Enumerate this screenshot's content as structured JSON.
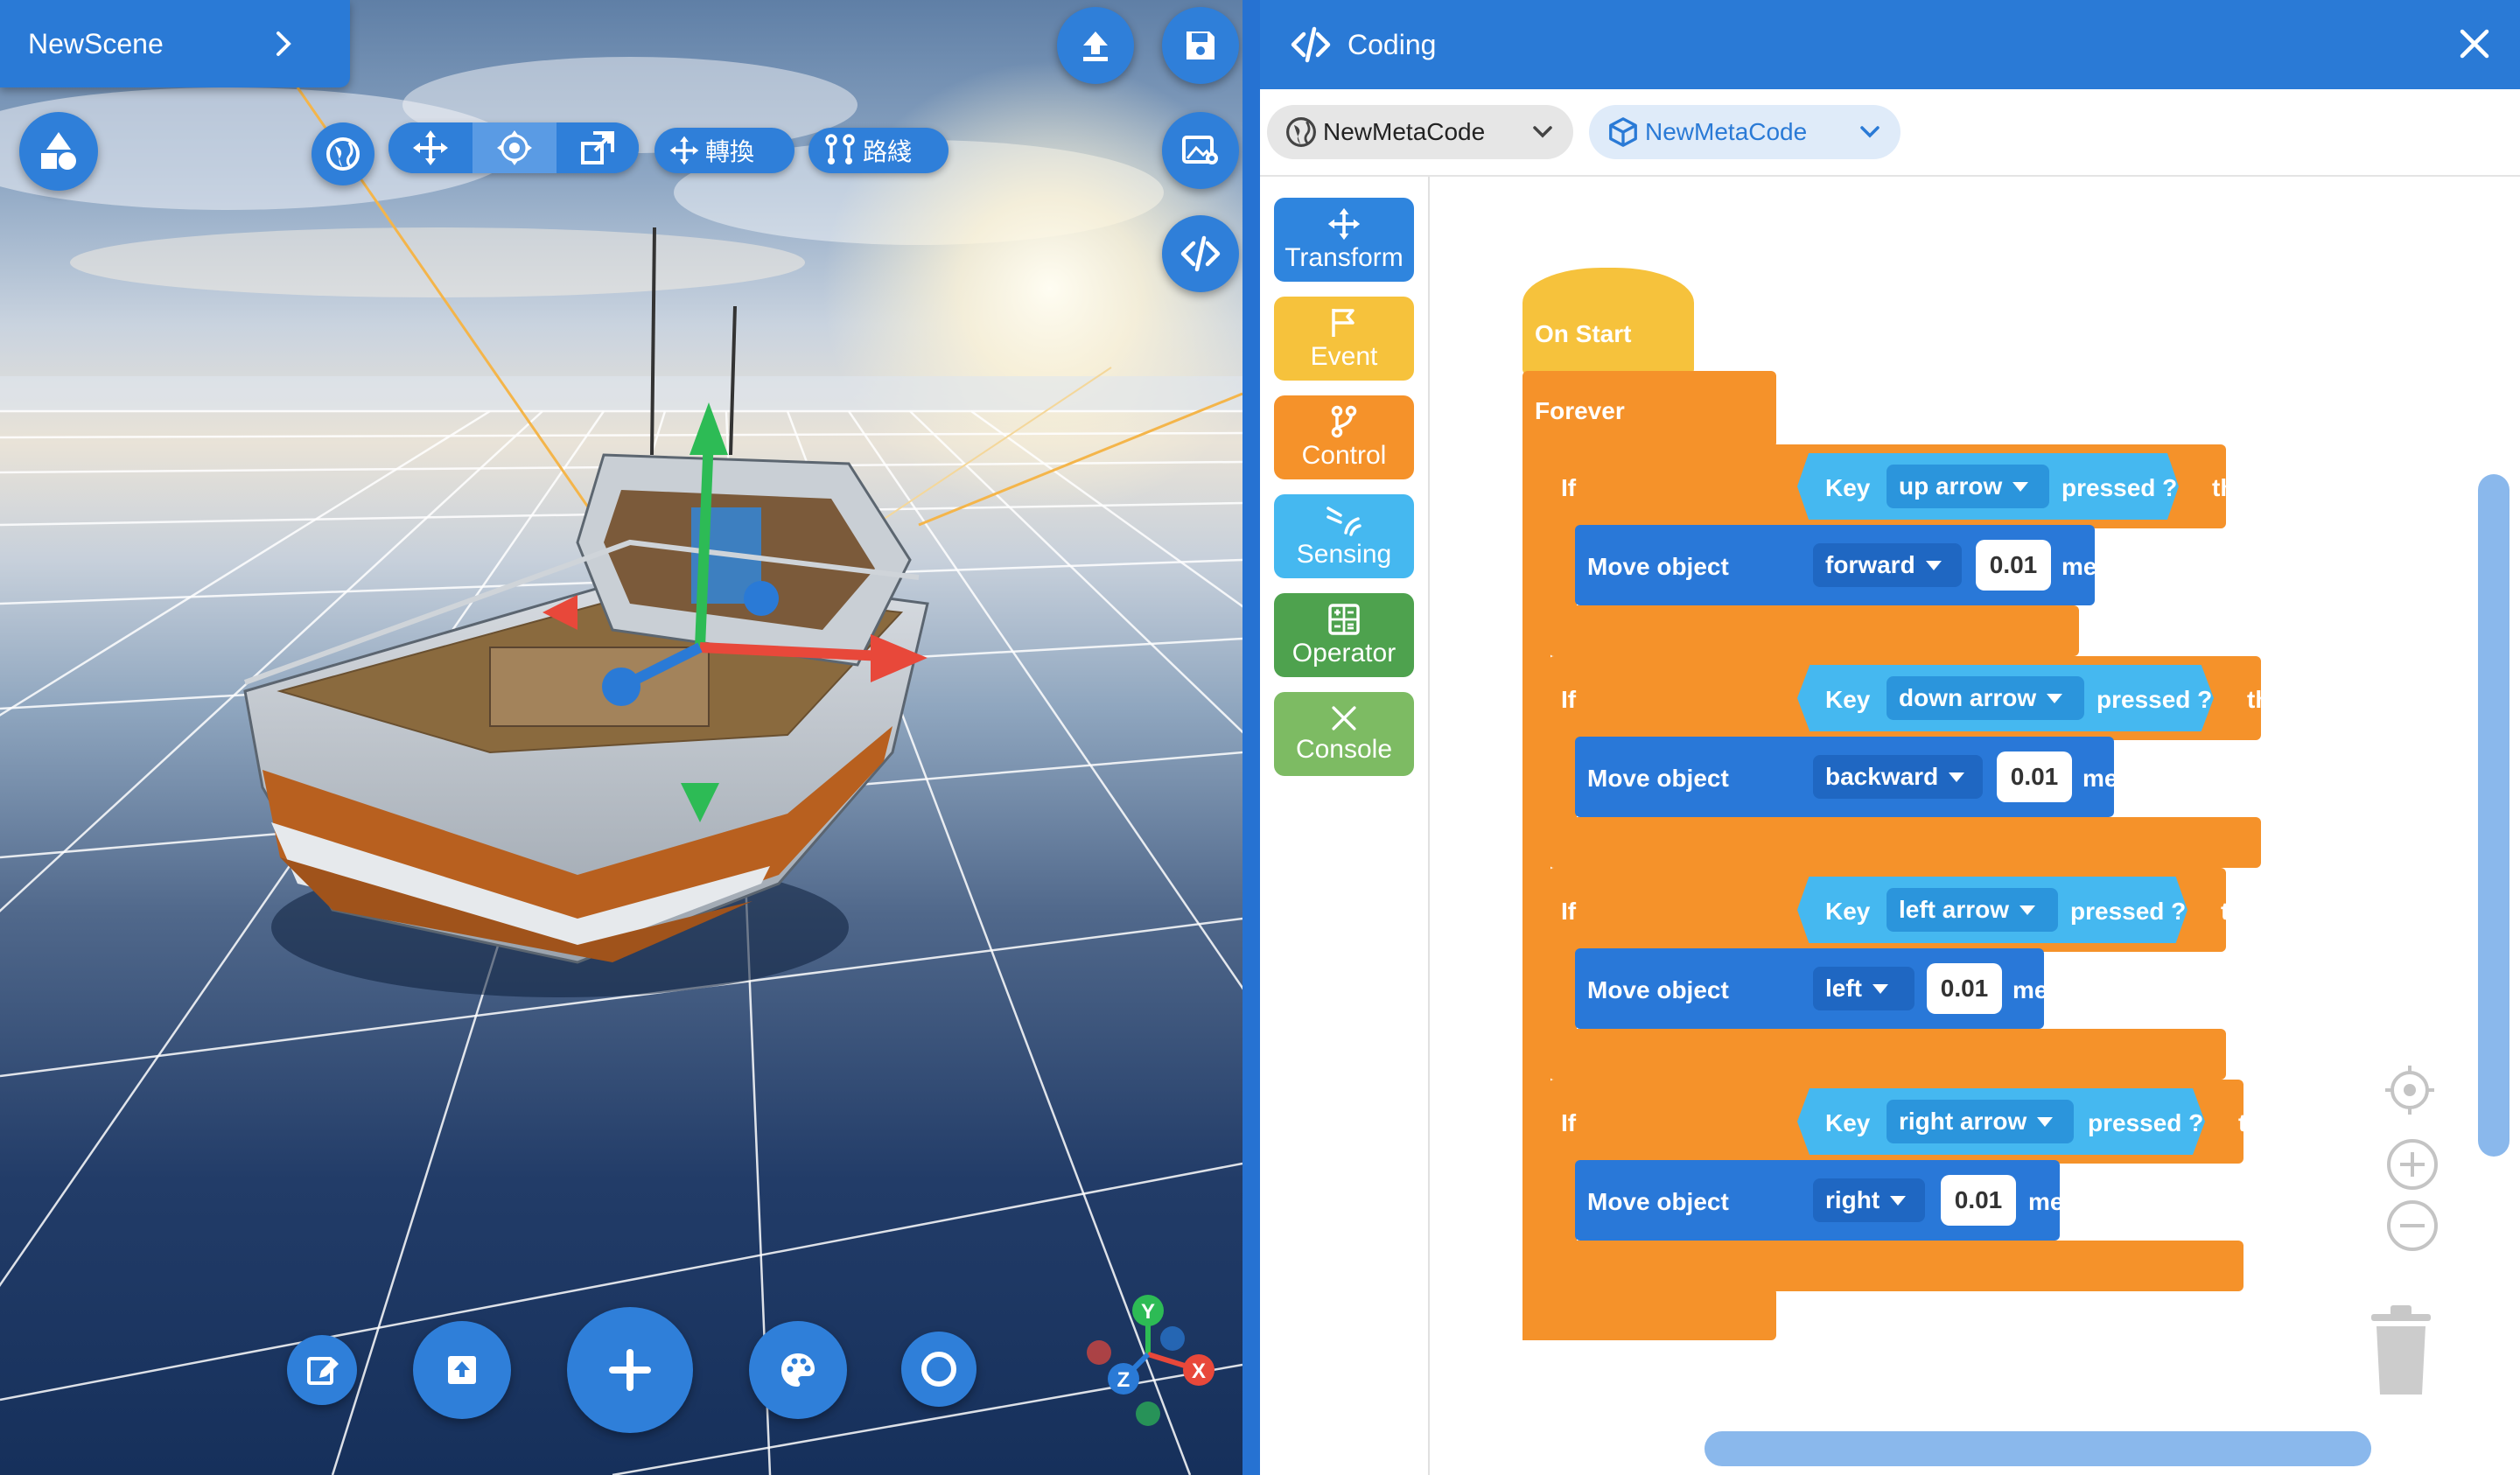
{
  "scene": {
    "title": "NewScene"
  },
  "toolbar": {
    "convert_label": "轉換",
    "path_label": "路綫"
  },
  "axis_gizmo": {
    "x": "X",
    "y": "Y",
    "z": "Z"
  },
  "panel": {
    "title": "Coding"
  },
  "tabs": [
    {
      "label": "NewMetaCode"
    },
    {
      "label": "NewMetaCode"
    }
  ],
  "categories": [
    {
      "label": "Transform",
      "color": "#2f85de"
    },
    {
      "label": "Event",
      "color": "#f6c23c"
    },
    {
      "label": "Control",
      "color": "#f5922a"
    },
    {
      "label": "Sensing",
      "color": "#45b8f0"
    },
    {
      "label": "Operator",
      "color": "#4ea24e"
    },
    {
      "label": "Console",
      "color": "#7dbb63"
    }
  ],
  "blocks": {
    "on_start": "On Start",
    "forever": "Forever",
    "if_word": "If",
    "key_word": "Key",
    "pressed_word": "pressed ?",
    "then_word": "then",
    "move_word": "Move object",
    "meters_word": "meters",
    "conditions": [
      {
        "key": "up arrow",
        "direction": "forward",
        "amount": "0.01"
      },
      {
        "key": "down arrow",
        "direction": "backward",
        "amount": "0.01"
      },
      {
        "key": "left arrow",
        "direction": "left",
        "amount": "0.01"
      },
      {
        "key": "right arrow",
        "direction": "right",
        "amount": "0.01"
      }
    ]
  },
  "colors": {
    "accent": "#2a7ad6",
    "event": "#f6c23c",
    "control": "#f5922a",
    "sensing": "#45b8f0",
    "motion": "#2978d8"
  }
}
